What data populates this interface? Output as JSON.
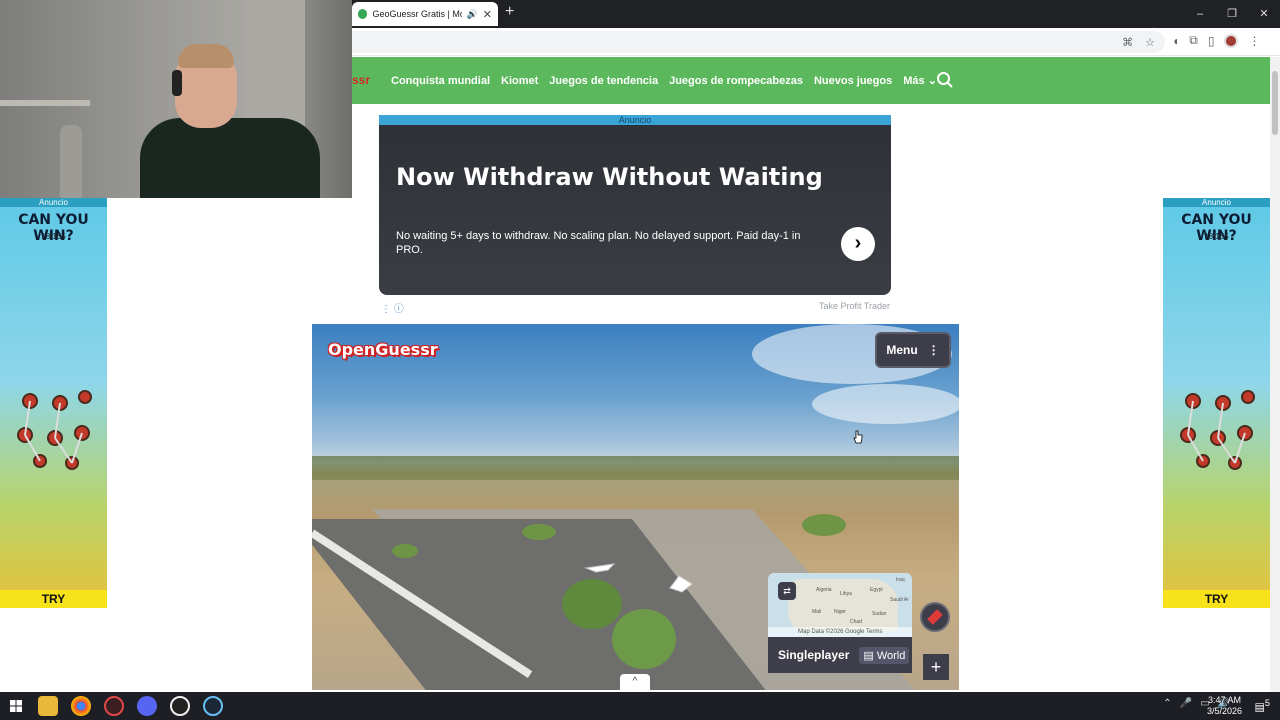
{
  "browser": {
    "tab_title": "GeoGuessr Gratis | Modo M",
    "new_tab": "+",
    "window_controls": [
      "–",
      "❐",
      "✕"
    ]
  },
  "site": {
    "brand_fragment": "ssr",
    "nav_links": [
      "Conquista mundial",
      "Kiomet",
      "Juegos de tendencia",
      "Juegos de rompecabezas",
      "Nuevos juegos",
      "Más ⌄"
    ]
  },
  "top_ad": {
    "label": "Anuncio",
    "headline": "Now Withdraw Without Waiting",
    "body": "No waiting 5+ days to withdraw. No scaling plan. No delayed support. Paid day-1 in PRO.",
    "sponsor": "Take Profit Trader",
    "info": "⋮ ⓘ"
  },
  "side_ad": {
    "label": "Anuncio",
    "headline": "CAN YOU WIN?",
    "score": "18/155",
    "cta": "TRY"
  },
  "game": {
    "logo": "OpenGuessr",
    "menu_label": "Menu",
    "mode_label": "Singleplayer",
    "region_label": "World",
    "map_attribution": "Map Data ©2026 Google   Terms",
    "map_labels": [
      "Algeria",
      "Libya",
      "Egypt",
      "Mali",
      "Niger",
      "Sudan",
      "Chad",
      "Iraq",
      "Saudi Ar"
    ],
    "zoom_in": "+",
    "collapse": "^"
  },
  "taskbar": {
    "time": "3:47 AM",
    "date": "3/5/2026",
    "notifications": "5"
  },
  "colors": {
    "nav_green": "#5cb85c",
    "ad_label_blue": "#3aa4d6",
    "game_panel_dark": "#3d3e4a",
    "logo_red": "#d02020"
  }
}
